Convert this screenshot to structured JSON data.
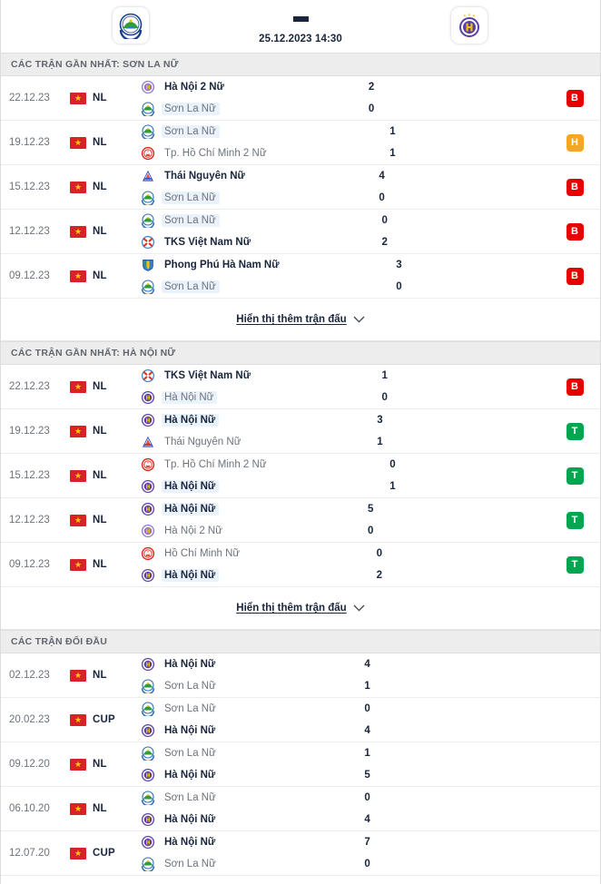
{
  "match_header": {
    "home_team": "Sơn La Nữ",
    "away_team": "Hà Nội Nữ",
    "score_separator": "-",
    "datetime": "25.12.2023 14:30",
    "home_crest_icon": "son-la-crest-icon",
    "away_crest_icon": "ha-noi-crest-icon"
  },
  "colors": {
    "loss": "#e70000",
    "draw": "#f5a623",
    "win": "#00a650",
    "highlight": "#eaf3fb",
    "text_dark": "#19253c",
    "text_muted": "#6c737c",
    "section_bg": "#ededed"
  },
  "sections": [
    {
      "id": "recent-son-la",
      "title": "CÁC TRẬN GẦN NHẤT: SƠN LA NỮ",
      "show_more_label": "Hiển thị thêm trận đấu",
      "matches": [
        {
          "date": "22.12.23",
          "league": "NL",
          "flag_icon": "vietnam-flag-icon",
          "home": {
            "name": "Hà Nội 2 Nữ",
            "crest": "ha-noi-2-crest-icon",
            "winner": true,
            "highlight": false
          },
          "away": {
            "name": "Sơn La Nữ",
            "crest": "son-la-crest-icon",
            "winner": false,
            "highlight": true
          },
          "home_score": "2",
          "away_score": "0",
          "result": "B",
          "result_type": "loss"
        },
        {
          "date": "19.12.23",
          "league": "NL",
          "flag_icon": "vietnam-flag-icon",
          "home": {
            "name": "Sơn La Nữ",
            "crest": "son-la-crest-icon",
            "winner": false,
            "highlight": true
          },
          "away": {
            "name": "Tp. Hồ Chí Minh 2 Nữ",
            "crest": "hcm-2-crest-icon",
            "winner": false,
            "highlight": false
          },
          "home_score": "1",
          "away_score": "1",
          "result": "H",
          "result_type": "draw"
        },
        {
          "date": "15.12.23",
          "league": "NL",
          "flag_icon": "vietnam-flag-icon",
          "home": {
            "name": "Thái Nguyên Nữ",
            "crest": "thai-nguyen-crest-icon",
            "winner": true,
            "highlight": false
          },
          "away": {
            "name": "Sơn La Nữ",
            "crest": "son-la-crest-icon",
            "winner": false,
            "highlight": true
          },
          "home_score": "4",
          "away_score": "0",
          "result": "B",
          "result_type": "loss"
        },
        {
          "date": "12.12.23",
          "league": "NL",
          "flag_icon": "vietnam-flag-icon",
          "home": {
            "name": "Sơn La Nữ",
            "crest": "son-la-crest-icon",
            "winner": false,
            "highlight": true
          },
          "away": {
            "name": "TKS Việt Nam Nữ",
            "crest": "tks-crest-icon",
            "winner": true,
            "highlight": false
          },
          "home_score": "0",
          "away_score": "2",
          "result": "B",
          "result_type": "loss"
        },
        {
          "date": "09.12.23",
          "league": "NL",
          "flag_icon": "vietnam-flag-icon",
          "home": {
            "name": "Phong Phú Hà Nam Nữ",
            "crest": "phong-phu-crest-icon",
            "winner": true,
            "highlight": false
          },
          "away": {
            "name": "Sơn La Nữ",
            "crest": "son-la-crest-icon",
            "winner": false,
            "highlight": true
          },
          "home_score": "3",
          "away_score": "0",
          "result": "B",
          "result_type": "loss"
        }
      ]
    },
    {
      "id": "recent-ha-noi",
      "title": "CÁC TRẬN GẦN NHẤT: HÀ NỘI NỮ",
      "show_more_label": "Hiển thị thêm trận đấu",
      "matches": [
        {
          "date": "22.12.23",
          "league": "NL",
          "flag_icon": "vietnam-flag-icon",
          "home": {
            "name": "TKS Việt Nam Nữ",
            "crest": "tks-crest-icon",
            "winner": true,
            "highlight": false
          },
          "away": {
            "name": "Hà Nội Nữ",
            "crest": "ha-noi-crest-icon",
            "winner": false,
            "highlight": true
          },
          "home_score": "1",
          "away_score": "0",
          "result": "B",
          "result_type": "loss"
        },
        {
          "date": "19.12.23",
          "league": "NL",
          "flag_icon": "vietnam-flag-icon",
          "home": {
            "name": "Hà Nội Nữ",
            "crest": "ha-noi-crest-icon",
            "winner": true,
            "highlight": true
          },
          "away": {
            "name": "Thái Nguyên Nữ",
            "crest": "thai-nguyen-crest-icon",
            "winner": false,
            "highlight": false
          },
          "home_score": "3",
          "away_score": "1",
          "result": "T",
          "result_type": "win"
        },
        {
          "date": "15.12.23",
          "league": "NL",
          "flag_icon": "vietnam-flag-icon",
          "home": {
            "name": "Tp. Hồ Chí Minh 2 Nữ",
            "crest": "hcm-2-crest-icon",
            "winner": false,
            "highlight": false
          },
          "away": {
            "name": "Hà Nội Nữ",
            "crest": "ha-noi-crest-icon",
            "winner": true,
            "highlight": true
          },
          "home_score": "0",
          "away_score": "1",
          "result": "T",
          "result_type": "win"
        },
        {
          "date": "12.12.23",
          "league": "NL",
          "flag_icon": "vietnam-flag-icon",
          "home": {
            "name": "Hà Nội Nữ",
            "crest": "ha-noi-crest-icon",
            "winner": true,
            "highlight": true
          },
          "away": {
            "name": "Hà Nội 2 Nữ",
            "crest": "ha-noi-2-crest-icon",
            "winner": false,
            "highlight": false
          },
          "home_score": "5",
          "away_score": "0",
          "result": "T",
          "result_type": "win"
        },
        {
          "date": "09.12.23",
          "league": "NL",
          "flag_icon": "vietnam-flag-icon",
          "home": {
            "name": "Hồ Chí Minh Nữ",
            "crest": "hcm-crest-icon",
            "winner": false,
            "highlight": false
          },
          "away": {
            "name": "Hà Nội Nữ",
            "crest": "ha-noi-crest-icon",
            "winner": true,
            "highlight": true
          },
          "home_score": "0",
          "away_score": "2",
          "result": "T",
          "result_type": "win"
        }
      ]
    },
    {
      "id": "head-to-head",
      "title": "CÁC TRẬN ĐỐI ĐẦU",
      "show_more_label": null,
      "matches": [
        {
          "date": "02.12.23",
          "league": "NL",
          "flag_icon": "vietnam-flag-icon",
          "home": {
            "name": "Hà Nội Nữ",
            "crest": "ha-noi-crest-icon",
            "winner": true,
            "highlight": false
          },
          "away": {
            "name": "Sơn La Nữ",
            "crest": "son-la-crest-icon",
            "winner": false,
            "highlight": false
          },
          "home_score": "4",
          "away_score": "1",
          "result": null,
          "result_type": null
        },
        {
          "date": "20.02.23",
          "league": "CUP",
          "flag_icon": "vietnam-flag-icon",
          "home": {
            "name": "Sơn La Nữ",
            "crest": "son-la-crest-icon",
            "winner": false,
            "highlight": false
          },
          "away": {
            "name": "Hà Nội Nữ",
            "crest": "ha-noi-crest-icon",
            "winner": true,
            "highlight": false
          },
          "home_score": "0",
          "away_score": "4",
          "result": null,
          "result_type": null
        },
        {
          "date": "09.12.20",
          "league": "NL",
          "flag_icon": "vietnam-flag-icon",
          "home": {
            "name": "Sơn La Nữ",
            "crest": "son-la-crest-icon",
            "winner": false,
            "highlight": false
          },
          "away": {
            "name": "Hà Nội Nữ",
            "crest": "ha-noi-crest-icon",
            "winner": true,
            "highlight": false
          },
          "home_score": "1",
          "away_score": "5",
          "result": null,
          "result_type": null
        },
        {
          "date": "06.10.20",
          "league": "NL",
          "flag_icon": "vietnam-flag-icon",
          "home": {
            "name": "Sơn La Nữ",
            "crest": "son-la-crest-icon",
            "winner": false,
            "highlight": false
          },
          "away": {
            "name": "Hà Nội Nữ",
            "crest": "ha-noi-crest-icon",
            "winner": true,
            "highlight": false
          },
          "home_score": "0",
          "away_score": "4",
          "result": null,
          "result_type": null
        },
        {
          "date": "12.07.20",
          "league": "CUP",
          "flag_icon": "vietnam-flag-icon",
          "home": {
            "name": "Hà Nội Nữ",
            "crest": "ha-noi-crest-icon",
            "winner": true,
            "highlight": false
          },
          "away": {
            "name": "Sơn La Nữ",
            "crest": "son-la-crest-icon",
            "winner": false,
            "highlight": false
          },
          "home_score": "7",
          "away_score": "0",
          "result": null,
          "result_type": null
        }
      ]
    }
  ]
}
